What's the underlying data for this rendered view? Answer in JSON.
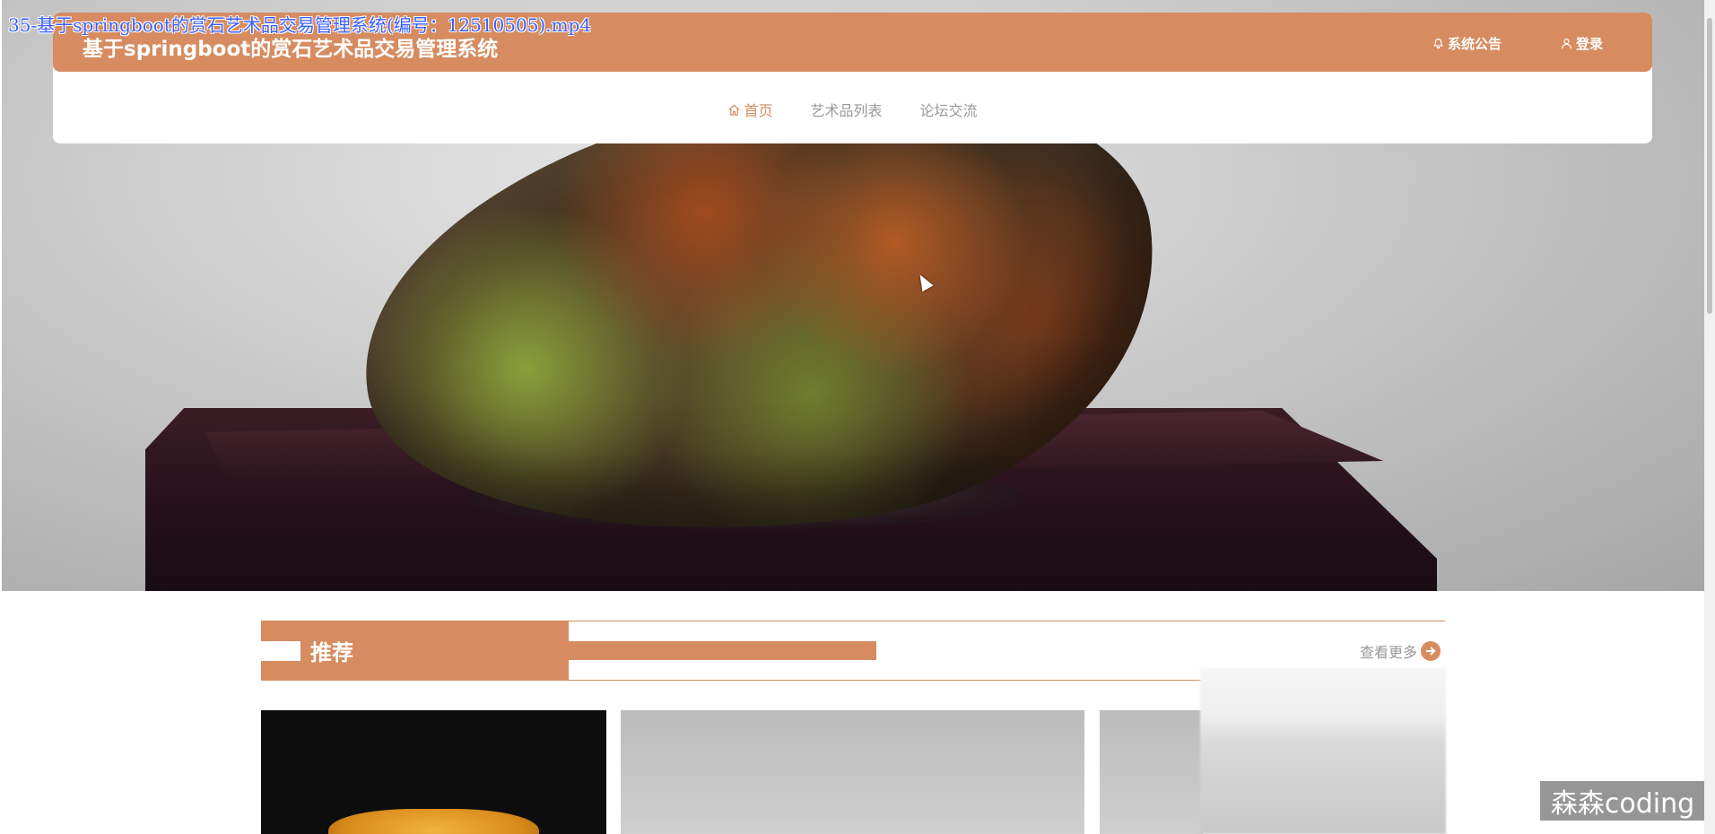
{
  "video_title": "35-基于springboot的赏石艺术品交易管理系统(编号：12510505).mp4",
  "header": {
    "site_title": "基于springboot的赏石艺术品交易管理系统",
    "notice_label": "系统公告",
    "login_label": "登录",
    "accent_color": "#d68c60"
  },
  "nav": {
    "items": [
      {
        "label": "首页",
        "icon": "home-icon",
        "active": true
      },
      {
        "label": "艺术品列表",
        "active": false
      },
      {
        "label": "论坛交流",
        "active": false
      }
    ]
  },
  "recommend": {
    "title": "推荐",
    "more_label": "查看更多",
    "more_icon": "arrow-right-circle-icon"
  },
  "watermark": "森森coding"
}
